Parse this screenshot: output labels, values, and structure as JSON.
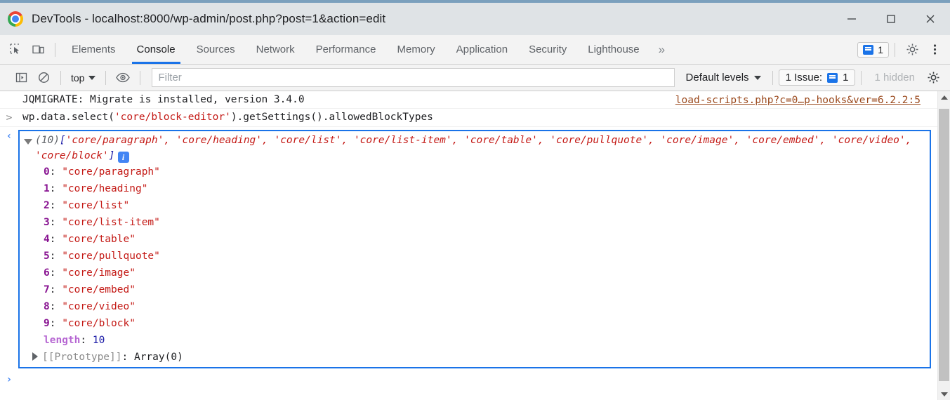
{
  "window": {
    "title": "DevTools - localhost:8000/wp-admin/post.php?post=1&action=edit",
    "logo_icon": "chrome-logo-icon",
    "minimize_icon": "minimize-icon",
    "maximize_icon": "maximize-icon",
    "close_icon": "close-icon"
  },
  "tabbar": {
    "inspect_icon": "inspect-element-icon",
    "device_icon": "device-toolbar-icon",
    "tabs": [
      {
        "label": "Elements",
        "active": false
      },
      {
        "label": "Console",
        "active": true
      },
      {
        "label": "Sources",
        "active": false
      },
      {
        "label": "Network",
        "active": false
      },
      {
        "label": "Performance",
        "active": false
      },
      {
        "label": "Memory",
        "active": false
      },
      {
        "label": "Application",
        "active": false
      },
      {
        "label": "Security",
        "active": false
      },
      {
        "label": "Lighthouse",
        "active": false
      }
    ],
    "more_tabs_label": "»",
    "issues_count": "1",
    "settings_icon": "gear-icon",
    "more_options_icon": "kebab-menu-icon"
  },
  "console_toolbar": {
    "sidebar_icon": "console-sidebar-icon",
    "clear_icon": "clear-console-icon",
    "context": "top",
    "eye_icon": "live-expression-icon",
    "filter_placeholder": "Filter",
    "filter_value": "",
    "levels_label": "Default levels",
    "issues_label": "1 Issue:",
    "issues_count": "1",
    "hidden_label": "1 hidden",
    "settings_icon": "console-settings-gear-icon"
  },
  "console": {
    "log_message": "JQMIGRATE: Migrate is installed, version 3.4.0",
    "log_source": "load-scripts.php?c=0…p-hooks&ver=6.2.2:5",
    "input_prompt": ">",
    "input_expression_part1": "wp.data.select(",
    "input_string": "'core/block-editor'",
    "input_expression_part2": ").getSettings().allowedBlockTypes",
    "result_prompt": "‹",
    "array_count": "(10)",
    "array_preview_open": "[",
    "array_preview_items": "'core/paragraph', 'core/heading', 'core/list', 'core/list-item', 'core/table', 'core/pullquote', 'core/image', 'core/embed', 'core/video', 'core/block'",
    "array_preview_close": "]",
    "info_badge": "i",
    "properties": [
      {
        "key": "0",
        "value": "\"core/paragraph\""
      },
      {
        "key": "1",
        "value": "\"core/heading\""
      },
      {
        "key": "2",
        "value": "\"core/list\""
      },
      {
        "key": "3",
        "value": "\"core/list-item\""
      },
      {
        "key": "4",
        "value": "\"core/table\""
      },
      {
        "key": "5",
        "value": "\"core/pullquote\""
      },
      {
        "key": "6",
        "value": "\"core/image\""
      },
      {
        "key": "7",
        "value": "\"core/embed\""
      },
      {
        "key": "8",
        "value": "\"core/video\""
      },
      {
        "key": "9",
        "value": "\"core/block\""
      }
    ],
    "length_key": "length",
    "length_value": "10",
    "prototype_key": "[[Prototype]]",
    "prototype_value": "Array(0)",
    "bottom_prompt": "›"
  },
  "colors": {
    "accent_blue": "#1a73e8",
    "string_red": "#c41a16",
    "index_purple": "#881391",
    "number_blue": "#1a1aa6",
    "link_brown": "#9b4a1e"
  }
}
